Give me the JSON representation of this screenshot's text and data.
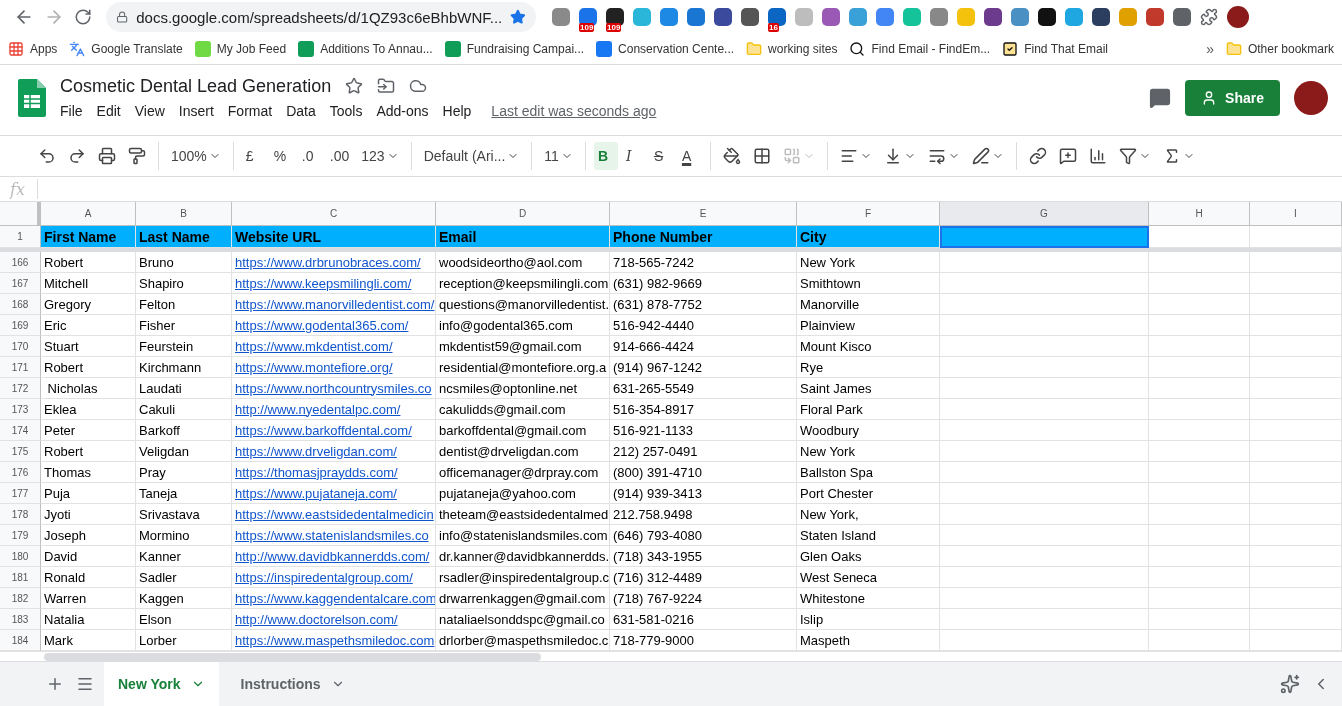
{
  "browser": {
    "url": "docs.google.com/spreadsheets/d/1QZ93c6eBhbWNF...",
    "extensions": [
      {
        "color": "#8a8a8a"
      },
      {
        "color": "#1a73e8",
        "badge": "109"
      },
      {
        "color": "#222222",
        "badge": "109"
      },
      {
        "color": "#29b6d8"
      },
      {
        "color": "#1e88e5"
      },
      {
        "color": "#1976d2"
      },
      {
        "color": "#3b4a9c"
      },
      {
        "color": "#555555"
      },
      {
        "color": "#0a66c2",
        "badge": "16"
      },
      {
        "color": "#bdbdbd"
      },
      {
        "color": "#9b59b6"
      },
      {
        "color": "#3aa0d8"
      },
      {
        "color": "#4285f4"
      },
      {
        "color": "#15c39a"
      },
      {
        "color": "#888888"
      },
      {
        "color": "#f4c20d"
      },
      {
        "color": "#6d3b8e"
      },
      {
        "color": "#4a90c2"
      },
      {
        "color": "#111111"
      },
      {
        "color": "#1ea7e1"
      },
      {
        "color": "#2c3e60"
      },
      {
        "color": "#e0a100"
      },
      {
        "color": "#c0392b"
      },
      {
        "color": "#5f6368"
      }
    ],
    "bookmarks": [
      {
        "kind": "apps",
        "label": "Apps"
      },
      {
        "kind": "translate",
        "label": "Google Translate"
      },
      {
        "kind": "upwork",
        "label": "My Job Feed"
      },
      {
        "kind": "sheet",
        "label": "Additions To Annau..."
      },
      {
        "kind": "sheet",
        "label": "Fundraising Campai..."
      },
      {
        "kind": "facebook",
        "label": "Conservation Cente..."
      },
      {
        "kind": "folder",
        "label": "working sites"
      },
      {
        "kind": "search",
        "label": "Find Email - FindEm..."
      },
      {
        "kind": "check",
        "label": "Find That Email"
      }
    ],
    "more": "»",
    "other_bookmarks": "Other bookmark"
  },
  "document": {
    "title": "Cosmetic Dental Lead Generation",
    "menus": [
      "File",
      "Edit",
      "View",
      "Insert",
      "Format",
      "Data",
      "Tools",
      "Add-ons",
      "Help"
    ],
    "last_edit": "Last edit was seconds ago",
    "share": "Share"
  },
  "toolbar_groups": [
    {
      "items": [
        {
          "kind": "undo"
        },
        {
          "kind": "redo"
        },
        {
          "kind": "print"
        },
        {
          "kind": "paint"
        }
      ]
    },
    {
      "items": [
        {
          "kind": "dropdown",
          "label": "100%"
        }
      ]
    },
    {
      "items": [
        {
          "kind": "text",
          "label": "£"
        },
        {
          "kind": "text",
          "label": "%"
        },
        {
          "kind": "text",
          "label": ".0"
        },
        {
          "kind": "text",
          "label": ".00"
        },
        {
          "kind": "dropdown",
          "label": "123"
        }
      ]
    },
    {
      "items": [
        {
          "kind": "dropdown",
          "label": "Default (Ari..."
        }
      ]
    },
    {
      "items": [
        {
          "kind": "dropdown",
          "label": "11"
        }
      ]
    },
    {
      "items": [
        {
          "kind": "bold",
          "label": "B",
          "on": true
        },
        {
          "kind": "italic",
          "label": "I",
          "on": false
        },
        {
          "kind": "strike",
          "label": "S",
          "on": false
        },
        {
          "kind": "color",
          "label": "A"
        }
      ]
    },
    {
      "items": [
        {
          "kind": "fill"
        },
        {
          "kind": "borders"
        },
        {
          "kind": "merge",
          "disabled": true
        }
      ]
    },
    {
      "items": [
        {
          "kind": "align"
        },
        {
          "kind": "valign"
        },
        {
          "kind": "wrap"
        },
        {
          "kind": "rotate"
        }
      ]
    },
    {
      "items": [
        {
          "kind": "link"
        },
        {
          "kind": "comment"
        },
        {
          "kind": "chart"
        },
        {
          "kind": "filter"
        },
        {
          "kind": "sum"
        }
      ]
    }
  ],
  "formula_bar": {
    "label": "fx"
  },
  "columns": [
    {
      "letter": "A",
      "header": "First Name",
      "kind": "text",
      "selected": false
    },
    {
      "letter": "B",
      "header": "Last Name",
      "kind": "text",
      "selected": false
    },
    {
      "letter": "C",
      "header": "Website URL",
      "kind": "link",
      "selected": false
    },
    {
      "letter": "D",
      "header": "Email",
      "kind": "text",
      "selected": false
    },
    {
      "letter": "E",
      "header": "Phone Number",
      "kind": "text",
      "selected": false
    },
    {
      "letter": "F",
      "header": "City",
      "kind": "text",
      "selected": false
    },
    {
      "letter": "G",
      "selected": true
    },
    {
      "letter": "H",
      "selected": false
    },
    {
      "letter": "I",
      "selected": false
    }
  ],
  "header_row": "1",
  "rows": [
    {
      "number": "166",
      "cells": [
        "Robert",
        "Bruno",
        "https://www.drbrunobraces.com/",
        "woodsideortho@aol.com",
        "718-565-7242",
        "New York"
      ]
    },
    {
      "number": "167",
      "cells": [
        "Mitchell",
        "Shapiro",
        "https://www.keepsmilingli.com/",
        "reception@keepsmilingli.com",
        "(631) 982-9669",
        "Smithtown"
      ]
    },
    {
      "number": "168",
      "cells": [
        "Gregory",
        "Felton",
        "https://www.manorvilledentist.com/",
        "questions@manorvilledentist.",
        "(631) 878-7752",
        "Manorville"
      ]
    },
    {
      "number": "169",
      "cells": [
        "Eric",
        "Fisher",
        "https://www.godental365.com/",
        "info@godental365.com",
        "516-942-4440",
        "Plainview"
      ]
    },
    {
      "number": "170",
      "cells": [
        "Stuart",
        "Feurstein",
        "https://www.mkdentist.com/",
        "mkdentist59@gmail.com",
        "914-666-4424",
        "Mount Kisco"
      ]
    },
    {
      "number": "171",
      "cells": [
        "Robert",
        "Kirchmann",
        "https://www.montefiore.org/",
        "residential@montefiore.org.a",
        "(914) 967-1242",
        "Rye"
      ]
    },
    {
      "number": "172",
      "cells": [
        " Nicholas",
        "Laudati",
        "https://www.northcountrysmiles.co",
        "ncsmiles@optonline.net",
        "631-265-5549",
        "Saint James"
      ]
    },
    {
      "number": "173",
      "cells": [
        "Eklea",
        "Cakuli",
        "http://www.nyedentalpc.com/",
        "cakulidds@gmail.com",
        "516-354-8917",
        "Floral Park"
      ]
    },
    {
      "number": "174",
      "cells": [
        "Peter",
        "Barkoff",
        "https://www.barkoffdental.com/",
        "barkoffdental@gmail.com",
        "516-921-1133",
        "Woodbury"
      ]
    },
    {
      "number": "175",
      "cells": [
        "Robert",
        "Veligdan",
        "https://www.drveligdan.com/",
        "dentist@drveligdan.com",
        "212) 257-0491",
        "New York"
      ]
    },
    {
      "number": "176",
      "cells": [
        "Thomas",
        "Pray",
        "https://thomasjpraydds.com/",
        "officemanager@drpray.com",
        "(800) 391-4710",
        "Ballston Spa"
      ]
    },
    {
      "number": "177",
      "cells": [
        "Puja",
        "Taneja",
        "https://www.pujataneja.com/",
        "pujataneja@yahoo.com",
        "(914) 939-3413",
        "Port Chester"
      ]
    },
    {
      "number": "178",
      "cells": [
        "Jyoti",
        "Srivastava",
        "https://www.eastsidedentalmedicin",
        "theteam@eastsidedentalmed",
        "212.758.9498",
        "New York,"
      ]
    },
    {
      "number": "179",
      "cells": [
        "Joseph",
        "Mormino",
        "https://www.statenislandsmiles.co",
        "info@statenislandsmiles.com",
        "(646) 793-4080",
        "Staten Island"
      ]
    },
    {
      "number": "180",
      "cells": [
        "David",
        "Kanner",
        "http://www.davidbkannerdds.com/",
        "dr.kanner@davidbkannerdds.",
        "(718) 343-1955",
        "Glen Oaks"
      ]
    },
    {
      "number": "181",
      "cells": [
        "Ronald",
        "Sadler",
        "https://inspiredentalgroup.com/",
        "rsadler@inspiredentalgroup.c",
        "(716) 312-4489",
        "West Seneca"
      ]
    },
    {
      "number": "182",
      "cells": [
        "Warren",
        "Kaggen",
        "https://www.kaggendentalcare.com",
        "drwarrenkaggen@gmail.com",
        "(718) 767-9224",
        "Whitestone"
      ]
    },
    {
      "number": "183",
      "cells": [
        "Natalia",
        "Elson",
        "http://www.doctorelson.com/",
        "nataliaelsonddspc@gmail.co",
        "631-581-0216",
        "Islip"
      ]
    },
    {
      "number": "184",
      "cells": [
        "Mark",
        "Lorber",
        "https://www.maspethsmiledoc.com",
        "drlorber@maspethsmiledoc.c",
        "718-779-9000",
        "Maspeth"
      ]
    }
  ],
  "sheet_tabs": [
    {
      "label": "New York",
      "selected": true
    },
    {
      "label": "Instructions",
      "selected": false
    }
  ]
}
